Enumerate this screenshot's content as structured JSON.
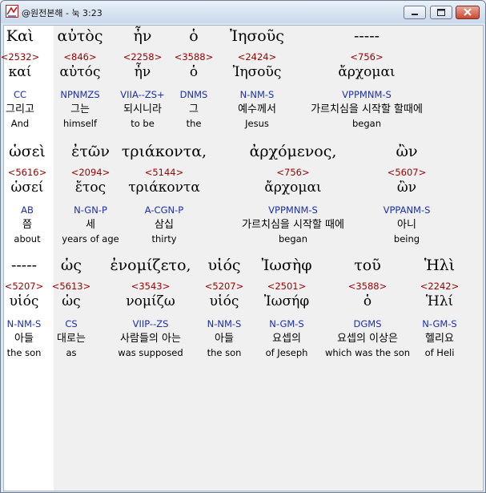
{
  "window": {
    "title": "@원전본해 - 눅 3:23",
    "app_icon": "app-logo-icon",
    "controls": [
      "minimize-icon",
      "maximize-icon",
      "close-icon"
    ]
  },
  "rows": [
    [
      {
        "greek": "Καὶ",
        "strongs": "<2532>",
        "lemma": "καί",
        "morph": "CC",
        "korean": "그리고",
        "english": "And"
      },
      {
        "greek": "αὐτὸς",
        "strongs": "<846>",
        "lemma": "αὐτός",
        "morph": "NPNMZS",
        "korean": "그는",
        "english": "himself"
      },
      {
        "greek": "ἦν",
        "strongs": "<2258>",
        "lemma": "ἦν",
        "morph": "VIIA--ZS+",
        "korean": "되시니라",
        "english": "to be"
      },
      {
        "greek": "ὁ",
        "strongs": "<3588>",
        "lemma": "ὁ",
        "morph": "DNMS",
        "korean": "그",
        "english": "the"
      },
      {
        "greek": "Ἰησοῦς",
        "strongs": "<2424>",
        "lemma": "Ἰησοῦς",
        "morph": "N-NM-S",
        "korean": "예수께서",
        "english": "Jesus"
      },
      {
        "greek": "-----",
        "strongs": "<756>",
        "lemma": "ἄρχομαι",
        "morph": "VPPMNM-S",
        "korean": "가르치심을 시작할 할때에",
        "english": "began"
      }
    ],
    [
      {
        "greek": "ὡσεὶ",
        "strongs": "<5616>",
        "lemma": "ὡσεί",
        "morph": "AB",
        "korean": "쯤",
        "english": "about"
      },
      {
        "greek": "ἐτῶν",
        "strongs": "<2094>",
        "lemma": "ἔτος",
        "morph": "N-GN-P",
        "korean": "세",
        "english": "years of age"
      },
      {
        "greek": "τριάκοντα,",
        "strongs": "<5144>",
        "lemma": "τριάκοντα",
        "morph": "A-CGN-P",
        "korean": "삼십",
        "english": "thirty"
      },
      {
        "greek": "ἀρχόμενος,",
        "strongs": "<756>",
        "lemma": "ἄρχομαι",
        "morph": "VPPMNM-S",
        "korean": "가르치심을 시작할 때에",
        "english": "began"
      },
      {
        "greek": "ὢν",
        "strongs": "<5607>",
        "lemma": "ὢν",
        "morph": "VPPANM-S",
        "korean": "아니",
        "english": "being"
      }
    ],
    [
      {
        "greek": "-----",
        "strongs": "<5207>",
        "lemma": "υἱός",
        "morph": "N-NM-S",
        "korean": "아들",
        "english": "the son"
      },
      {
        "greek": "ὡς",
        "strongs": "<5613>",
        "lemma": "ὡς",
        "morph": "CS",
        "korean": "대로는",
        "english": "as"
      },
      {
        "greek": "ἐνομίζετο,",
        "strongs": "<3543>",
        "lemma": "νομίζω",
        "morph": "VIIP--ZS",
        "korean": "사람들의 아는",
        "english": "was supposed"
      },
      {
        "greek": "υἱός",
        "strongs": "<5207>",
        "lemma": "υἱός",
        "morph": "N-NM-S",
        "korean": "아들",
        "english": "the son"
      },
      {
        "greek": "Ἰωσὴφ",
        "strongs": "<2501>",
        "lemma": "Ἰωσήφ",
        "morph": "N-GM-S",
        "korean": "요셉의",
        "english": "of Jeseph"
      },
      {
        "greek": "τοῦ",
        "strongs": "<3588>",
        "lemma": "ὁ",
        "morph": "DGMS",
        "korean": "요셉의 이상은",
        "english": "which was the son"
      },
      {
        "greek": "Ἡλὶ",
        "strongs": "<2242>",
        "lemma": "Ἡλί",
        "morph": "N-GM-S",
        "korean": "헬리요",
        "english": "of Heli"
      }
    ]
  ]
}
